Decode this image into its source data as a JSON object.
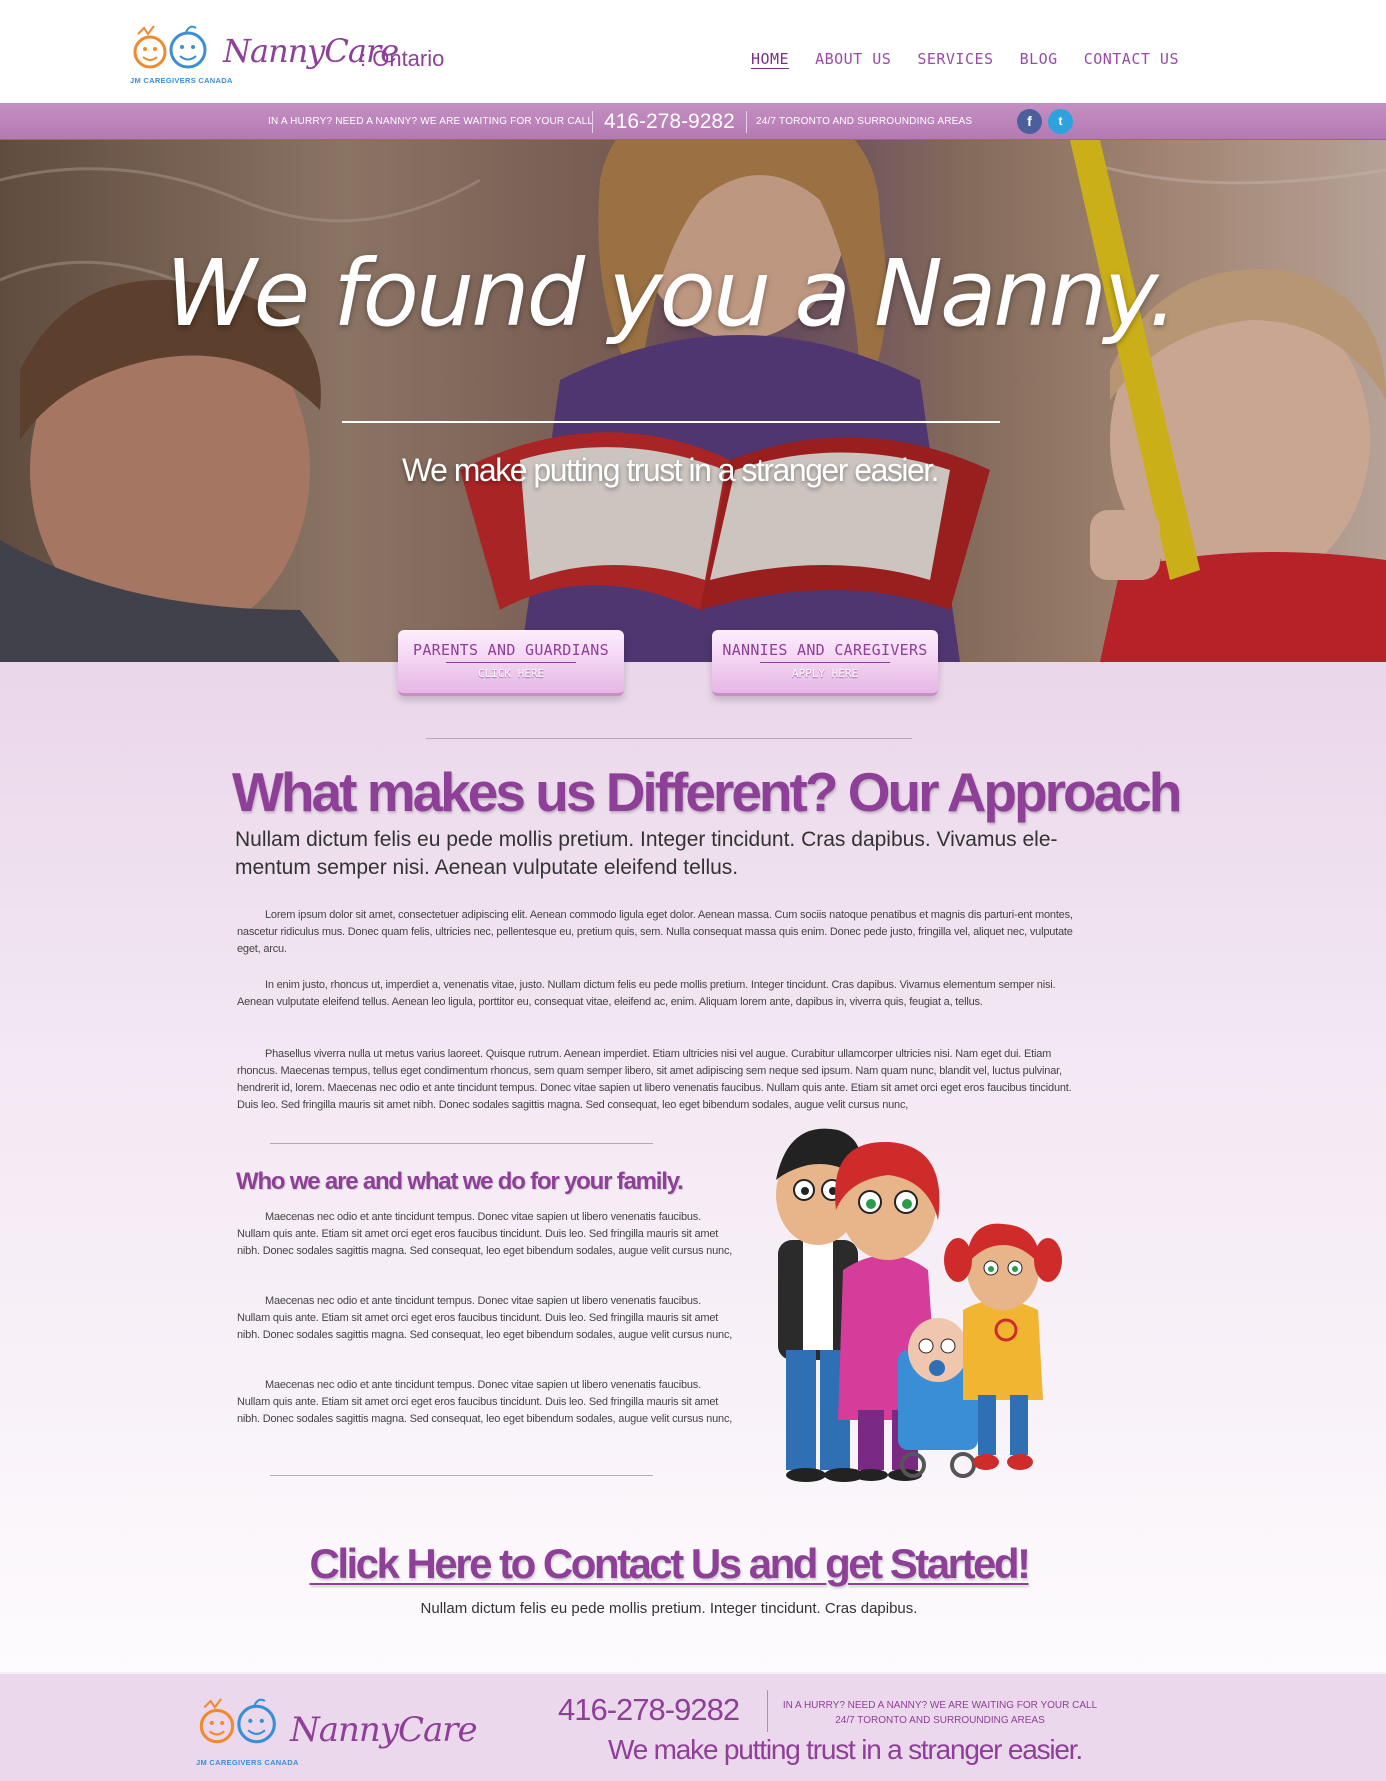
{
  "brand": {
    "name": "NannyCare",
    "region": ": Ontario",
    "subtitle": "JM CAREGIVERS CANADA"
  },
  "nav": {
    "items": [
      "HOME",
      "ABOUT US",
      "SERVICES",
      "BLOG",
      "CONTACT US"
    ],
    "active": "HOME"
  },
  "strip": {
    "hurry": "IN A HURRY? NEED A NANNY? WE ARE WAITING FOR YOUR CALL",
    "phone": "416-278-9282",
    "areas": "24/7 TORONTO AND SURROUNDING AREAS",
    "social": [
      "facebook-icon",
      "twitter-icon"
    ]
  },
  "hero": {
    "title": "We found you a Nanny.",
    "subtitle": "We make putting trust in a stranger easier."
  },
  "cta": {
    "parents": {
      "title": "PARENTS AND GUARDIANS",
      "action": "CLICK HERE"
    },
    "nannies": {
      "title": "NANNIES AND CAREGIVERS",
      "action": "APPLY HERE"
    }
  },
  "approach": {
    "heading": "What makes us Different?  Our Approach",
    "lead": "Nullam dictum felis eu pede mollis pretium. Integer tincidunt. Cras dapibus. Vivamus ele-mentum semper nisi. Aenean vulputate eleifend tellus.",
    "paragraphs": [
      "Lorem ipsum dolor sit amet, consectetuer adipiscing elit. Aenean commodo ligula eget dolor. Aenean massa. Cum sociis natoque penatibus et magnis dis parturi-ent montes, nascetur ridiculus mus. Donec quam felis, ultricies nec, pellentesque eu, pretium quis, sem. Nulla consequat massa quis enim. Donec pede justo, fringilla vel, aliquet nec, vulputate eget, arcu.",
      "In enim justo, rhoncus ut, imperdiet a, venenatis vitae, justo. Nullam dictum felis eu pede mollis pretium. Integer tincidunt. Cras dapibus. Vivamus elementum semper nisi. Aenean vulputate eleifend tellus. Aenean leo ligula, porttitor eu, consequat vitae, eleifend ac, enim. Aliquam lorem ante, dapibus in, viverra quis, feugiat a, tellus.",
      "Phasellus viverra nulla ut metus varius laoreet. Quisque rutrum. Aenean imperdiet. Etiam ultricies nisi vel augue. Curabitur ullamcorper ultricies nisi. Nam eget dui. Etiam rhoncus. Maecenas tempus, tellus eget condimentum rhoncus, sem quam semper libero, sit amet adipiscing sem neque sed ipsum. Nam quam nunc, blandit vel, luctus pulvinar, hendrerit id, lorem. Maecenas nec odio et ante tincidunt tempus. Donec vitae sapien ut libero venenatis faucibus. Nullam quis ante. Etiam sit amet orci eget eros faucibus tincidunt. Duis leo. Sed fringilla mauris sit amet nibh. Donec sodales sagittis magna. Sed consequat, leo eget bibendum sodales, augue velit cursus nunc,"
    ]
  },
  "who": {
    "heading": "Who we are and what we do for your family.",
    "paragraphs": [
      "Maecenas nec odio et ante tincidunt tempus. Donec vitae sapien ut libero venenatis faucibus. Nullam quis ante. Etiam sit amet orci eget eros faucibus tincidunt. Duis leo. Sed fringilla mauris sit amet nibh. Donec sodales sagittis magna. Sed consequat, leo eget bibendum sodales, augue velit cursus nunc,",
      "Maecenas nec odio et ante tincidunt tempus. Donec vitae sapien ut libero venenatis faucibus. Nullam quis ante. Etiam sit amet orci eget eros faucibus tincidunt. Duis leo. Sed fringilla mauris sit amet nibh. Donec sodales sagittis magna. Sed consequat, leo eget bibendum sodales, augue velit cursus nunc,",
      "Maecenas nec odio et ante tincidunt tempus. Donec vitae sapien ut libero venenatis faucibus. Nullam quis ante. Etiam sit amet orci eget eros faucibus tincidunt. Duis leo. Sed fringilla mauris sit amet nibh. Donec sodales sagittis magna. Sed consequat, leo eget bibendum sodales, augue velit cursus nunc,"
    ]
  },
  "contact": {
    "heading": "Click Here to Contact Us and get Started!",
    "sub": "Nullam dictum felis eu pede mollis pretium. Integer tincidunt. Cras dapibus."
  },
  "footer": {
    "phone": "416-278-9282",
    "hurry": "IN A HURRY? NEED A NANNY? WE ARE WAITING FOR YOUR CALL",
    "areas": "24/7 TORONTO AND SURROUNDING AREAS",
    "tagline": "We make putting trust in a stranger easier."
  },
  "colors": {
    "brand_purple": "#8e3f97",
    "strip": "#b37ab2",
    "background": "#ead7ea"
  }
}
